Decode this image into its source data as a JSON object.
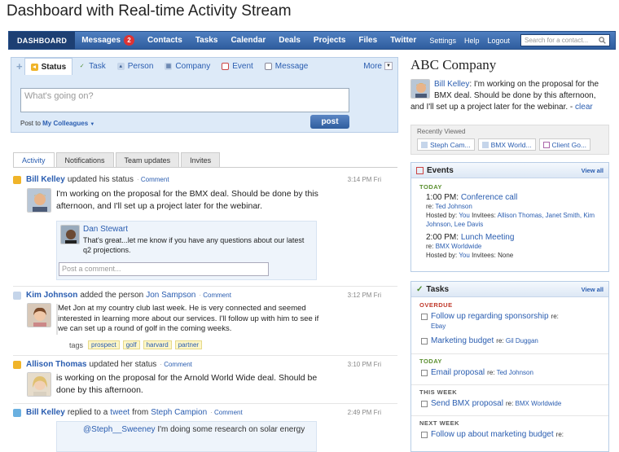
{
  "page_title": "Dashboard with Real-time Activity Stream",
  "nav": {
    "dashboard": "DASHBOARD",
    "items": [
      "Messages",
      "Contacts",
      "Tasks",
      "Calendar",
      "Deals",
      "Projects",
      "Files",
      "Twitter"
    ],
    "messages_badge": "2",
    "right_items": [
      "Settings",
      "Help",
      "Logout"
    ],
    "search_placeholder": "Search for a contact..."
  },
  "composer": {
    "tabs": [
      "Status",
      "Task",
      "Person",
      "Company",
      "Event",
      "Message"
    ],
    "more": "More",
    "placeholder": "What's going on?",
    "post_to_label": "Post to",
    "post_to_value": "My Colleagues",
    "post_button": "post"
  },
  "feed_tabs": [
    "Activity",
    "Notifications",
    "Team updates",
    "Invites"
  ],
  "feed": [
    {
      "actor": "Bill Kelley",
      "verb": "updated his status",
      "comment": "Comment",
      "time": "3:14 PM Fri",
      "body": "I'm working on the proposal for the BMX deal. Should be done by this afternoon, and I'll set up a project later for the webinar.",
      "reply": {
        "name": "Dan Stewart",
        "text": "That's great...let me know if you have any questions about our latest q2 projections.",
        "comment_placeholder": "Post a comment..."
      }
    },
    {
      "actor": "Kim Johnson",
      "verb": "added the person",
      "object": "Jon Sampson",
      "comment": "Comment",
      "time": "3:12 PM Fri",
      "body": "Met Jon at my country club last week. He is very connected and seemed interested in learning more about our services. I'll follow up with him to see if we can set up a round of golf in the coming weeks.",
      "tags_label": "tags",
      "tags": [
        "prospect",
        "golf",
        "harvard",
        "partner"
      ]
    },
    {
      "actor": "Allison Thomas",
      "verb": "updated her status",
      "comment": "Comment",
      "time": "3:10 PM Fri",
      "body": "is working on the proposal for the Arnold World Wide deal. Should be done by this afternoon."
    },
    {
      "actor": "Bill Kelley",
      "verb": "replied to a",
      "object": "tweet",
      "verb2": "from",
      "object2": "Steph Campion",
      "comment": "Comment",
      "time": "2:49 PM Fri",
      "tweet_user": "@Steph__Sweeney",
      "tweet_text": "I'm doing some research on solar energy"
    }
  ],
  "company": {
    "name": "ABC Company",
    "status_who": "Bill Kelley",
    "status_text": ": I'm working on the proposal for the BMX deal. Should be done by this afternoon, and I'll set up a project later for the webinar.",
    "clear": "clear",
    "recently_viewed_label": "Recently Viewed",
    "recently_viewed": [
      "Steph Cam...",
      "BMX World...",
      "Client Go..."
    ]
  },
  "events": {
    "title": "Events",
    "view_all": "View all",
    "today_label": "TODAY",
    "items": [
      {
        "time": "1:00 PM:",
        "title": "Conference call",
        "re_label": "re:",
        "re": "Ted Johnson",
        "hosted_label": "Hosted by:",
        "host": "You",
        "invitees_label": "Invitees:",
        "invitees": "Allison Thomas, Janet Smith, Kim Johnson, Lee Davis"
      },
      {
        "time": "2:00 PM:",
        "title": "Lunch Meeting",
        "re_label": "re:",
        "re": "BMX Worldwide",
        "hosted_label": "Hosted by:",
        "host": "You",
        "invitees_label": "Invitees:",
        "invitees": "None"
      }
    ]
  },
  "tasks": {
    "title": "Tasks",
    "view_all": "View all",
    "overdue_label": "OVERDUE",
    "today_label": "TODAY",
    "this_week_label": "THIS WEEK",
    "next_week_label": "NEXT WEEK",
    "re_label": "re:",
    "overdue": [
      {
        "title": "Follow up regarding sponsorship",
        "re": "Ebay"
      },
      {
        "title": "Marketing budget",
        "re": "Gil Duggan"
      }
    ],
    "today": [
      {
        "title": "Email proposal",
        "re": "Ted Johnson"
      }
    ],
    "this_week": [
      {
        "title": "Send BMX proposal",
        "re": "BMX Worldwide"
      }
    ],
    "next_week": [
      {
        "title": "Follow up about marketing budget",
        "re": ""
      }
    ]
  },
  "colors": {
    "nav_blue": "#2f5d9e",
    "link_blue": "#2a5db0",
    "overdue_red": "#c0392b",
    "today_green": "#5a8f2e",
    "week_gray": "#555555"
  }
}
